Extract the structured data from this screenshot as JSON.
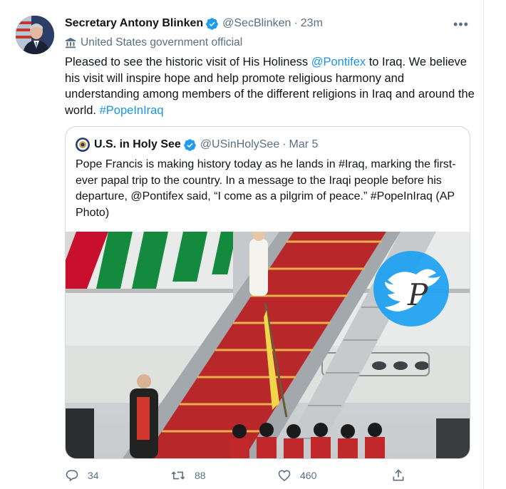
{
  "tweet": {
    "display_name": "Secretary Antony Blinken",
    "handle": "@SecBlinken",
    "separator": "·",
    "time": "23m",
    "more": "•••",
    "gov_label": "United States government official",
    "text": {
      "p1": "Pleased to see the historic visit of His Holiness ",
      "mention": "@Pontifex",
      "p2": " to Iraq. We believe his visit will inspire hope and help promote religious harmony and understanding among members of the different religions in Iraq and around the world. ",
      "hashtag": "#PopeInIraq"
    }
  },
  "quoted": {
    "display_name": "U.S. in Holy See",
    "handle": "@USinHolySee",
    "separator": "·",
    "date": "Mar 5",
    "text": "Pope Francis is making history today as he lands in #Iraq, marking the first-ever papal trip to the country. In a message to the Iraqi people before his departure, @Pontifex said, “I come as a pilgrim of peace.” #PopeInIraq (AP Photo)",
    "photo_watermark": "P"
  },
  "actions": {
    "reply_count": "34",
    "retweet_count": "88",
    "like_count": "460"
  },
  "colors": {
    "accent": "#1b95e0",
    "text": "#0f1419",
    "secondary": "#5b7083",
    "verified": "#1d9bf0",
    "border": "#cfd9de"
  },
  "icons": [
    "verified-badge-icon",
    "government-building-icon",
    "more-icon",
    "reply-icon",
    "retweet-icon",
    "like-icon",
    "share-icon"
  ]
}
